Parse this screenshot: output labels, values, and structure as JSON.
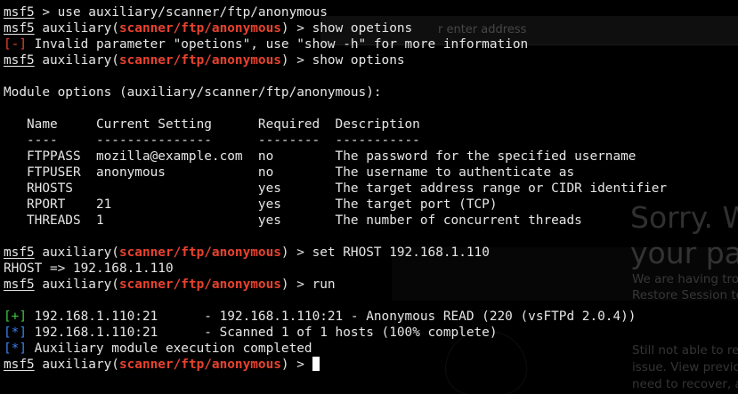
{
  "background_page": {
    "address_placeholder": "r enter address",
    "sorry_title": [
      "Sorry. W",
      "your pag"
    ],
    "lines": [
      "We are having tro",
      "Restore Session to",
      "Still not able to res",
      "issue. View previo",
      "need to recover, a"
    ]
  },
  "terminal": {
    "prompt_label": "msf5",
    "module_path": "scanner/ftp/anonymous",
    "lines": [
      {
        "kind": "prompt_plain",
        "text": " > use auxiliary/scanner/ftp/anonymous"
      },
      {
        "kind": "prompt_module",
        "text": " > show opetions"
      },
      {
        "kind": "status",
        "tag": "[-]",
        "tag_class": "tag-err",
        "text": " Invalid parameter \"opetions\", use \"show -h\" for more information"
      },
      {
        "kind": "prompt_module",
        "text": " > show options"
      },
      {
        "kind": "text",
        "text": ""
      },
      {
        "kind": "text",
        "text": "Module options (auxiliary/scanner/ftp/anonymous):"
      },
      {
        "kind": "text",
        "text": ""
      },
      {
        "kind": "text",
        "text": "   Name     Current Setting      Required  Description"
      },
      {
        "kind": "text",
        "text": "   ----     ---------------      --------  -----------"
      },
      {
        "kind": "text",
        "text": "   FTPPASS  mozilla@example.com  no        The password for the specified username"
      },
      {
        "kind": "text",
        "text": "   FTPUSER  anonymous            no        The username to authenticate as"
      },
      {
        "kind": "text",
        "text": "   RHOSTS                        yes       The target address range or CIDR identifier"
      },
      {
        "kind": "text",
        "text": "   RPORT    21                   yes       The target port (TCP)"
      },
      {
        "kind": "text",
        "text": "   THREADS  1                    yes       The number of concurrent threads"
      },
      {
        "kind": "text",
        "text": ""
      },
      {
        "kind": "prompt_module",
        "text": " > set RHOST 192.168.1.110"
      },
      {
        "kind": "text",
        "text": "RHOST => 192.168.1.110"
      },
      {
        "kind": "prompt_module",
        "text": " > run"
      },
      {
        "kind": "text",
        "text": ""
      },
      {
        "kind": "status",
        "tag": "[+]",
        "tag_class": "tag-good",
        "text": " 192.168.1.110:21      - 192.168.1.110:21 - Anonymous READ (220 (vsFTPd 2.0.4))"
      },
      {
        "kind": "status",
        "tag": "[*]",
        "tag_class": "tag-info",
        "text": " 192.168.1.110:21      - Scanned 1 of 1 hosts (100% complete)"
      },
      {
        "kind": "status",
        "tag": "[*]",
        "tag_class": "tag-info",
        "text": " Auxiliary module execution completed"
      },
      {
        "kind": "prompt_module_cursor",
        "text": " > "
      }
    ]
  }
}
